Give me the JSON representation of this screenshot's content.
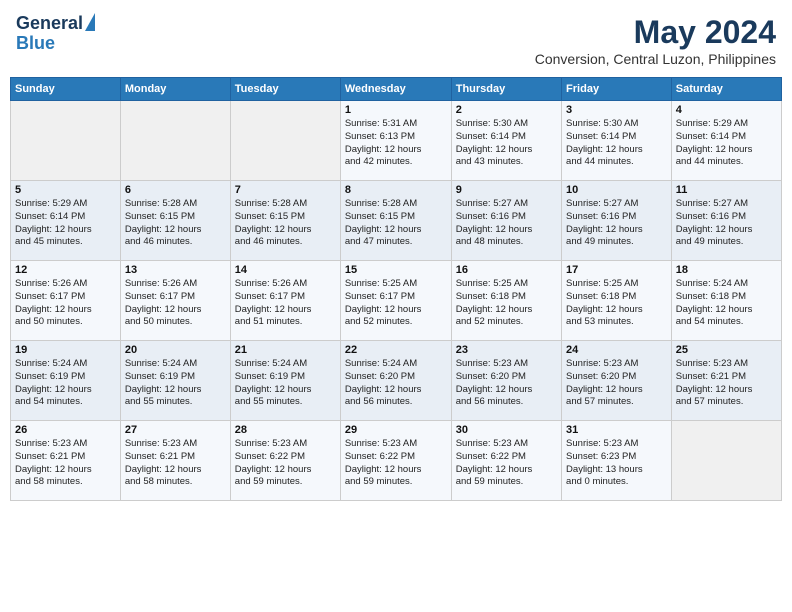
{
  "header": {
    "logo_line1": "General",
    "logo_line2": "Blue",
    "month_year": "May 2024",
    "location": "Conversion, Central Luzon, Philippines"
  },
  "weekdays": [
    "Sunday",
    "Monday",
    "Tuesday",
    "Wednesday",
    "Thursday",
    "Friday",
    "Saturday"
  ],
  "weeks": [
    [
      {
        "day": "",
        "info": ""
      },
      {
        "day": "",
        "info": ""
      },
      {
        "day": "",
        "info": ""
      },
      {
        "day": "1",
        "info": "Sunrise: 5:31 AM\nSunset: 6:13 PM\nDaylight: 12 hours\nand 42 minutes."
      },
      {
        "day": "2",
        "info": "Sunrise: 5:30 AM\nSunset: 6:14 PM\nDaylight: 12 hours\nand 43 minutes."
      },
      {
        "day": "3",
        "info": "Sunrise: 5:30 AM\nSunset: 6:14 PM\nDaylight: 12 hours\nand 44 minutes."
      },
      {
        "day": "4",
        "info": "Sunrise: 5:29 AM\nSunset: 6:14 PM\nDaylight: 12 hours\nand 44 minutes."
      }
    ],
    [
      {
        "day": "5",
        "info": "Sunrise: 5:29 AM\nSunset: 6:14 PM\nDaylight: 12 hours\nand 45 minutes."
      },
      {
        "day": "6",
        "info": "Sunrise: 5:28 AM\nSunset: 6:15 PM\nDaylight: 12 hours\nand 46 minutes."
      },
      {
        "day": "7",
        "info": "Sunrise: 5:28 AM\nSunset: 6:15 PM\nDaylight: 12 hours\nand 46 minutes."
      },
      {
        "day": "8",
        "info": "Sunrise: 5:28 AM\nSunset: 6:15 PM\nDaylight: 12 hours\nand 47 minutes."
      },
      {
        "day": "9",
        "info": "Sunrise: 5:27 AM\nSunset: 6:16 PM\nDaylight: 12 hours\nand 48 minutes."
      },
      {
        "day": "10",
        "info": "Sunrise: 5:27 AM\nSunset: 6:16 PM\nDaylight: 12 hours\nand 49 minutes."
      },
      {
        "day": "11",
        "info": "Sunrise: 5:27 AM\nSunset: 6:16 PM\nDaylight: 12 hours\nand 49 minutes."
      }
    ],
    [
      {
        "day": "12",
        "info": "Sunrise: 5:26 AM\nSunset: 6:17 PM\nDaylight: 12 hours\nand 50 minutes."
      },
      {
        "day": "13",
        "info": "Sunrise: 5:26 AM\nSunset: 6:17 PM\nDaylight: 12 hours\nand 50 minutes."
      },
      {
        "day": "14",
        "info": "Sunrise: 5:26 AM\nSunset: 6:17 PM\nDaylight: 12 hours\nand 51 minutes."
      },
      {
        "day": "15",
        "info": "Sunrise: 5:25 AM\nSunset: 6:17 PM\nDaylight: 12 hours\nand 52 minutes."
      },
      {
        "day": "16",
        "info": "Sunrise: 5:25 AM\nSunset: 6:18 PM\nDaylight: 12 hours\nand 52 minutes."
      },
      {
        "day": "17",
        "info": "Sunrise: 5:25 AM\nSunset: 6:18 PM\nDaylight: 12 hours\nand 53 minutes."
      },
      {
        "day": "18",
        "info": "Sunrise: 5:24 AM\nSunset: 6:18 PM\nDaylight: 12 hours\nand 54 minutes."
      }
    ],
    [
      {
        "day": "19",
        "info": "Sunrise: 5:24 AM\nSunset: 6:19 PM\nDaylight: 12 hours\nand 54 minutes."
      },
      {
        "day": "20",
        "info": "Sunrise: 5:24 AM\nSunset: 6:19 PM\nDaylight: 12 hours\nand 55 minutes."
      },
      {
        "day": "21",
        "info": "Sunrise: 5:24 AM\nSunset: 6:19 PM\nDaylight: 12 hours\nand 55 minutes."
      },
      {
        "day": "22",
        "info": "Sunrise: 5:24 AM\nSunset: 6:20 PM\nDaylight: 12 hours\nand 56 minutes."
      },
      {
        "day": "23",
        "info": "Sunrise: 5:23 AM\nSunset: 6:20 PM\nDaylight: 12 hours\nand 56 minutes."
      },
      {
        "day": "24",
        "info": "Sunrise: 5:23 AM\nSunset: 6:20 PM\nDaylight: 12 hours\nand 57 minutes."
      },
      {
        "day": "25",
        "info": "Sunrise: 5:23 AM\nSunset: 6:21 PM\nDaylight: 12 hours\nand 57 minutes."
      }
    ],
    [
      {
        "day": "26",
        "info": "Sunrise: 5:23 AM\nSunset: 6:21 PM\nDaylight: 12 hours\nand 58 minutes."
      },
      {
        "day": "27",
        "info": "Sunrise: 5:23 AM\nSunset: 6:21 PM\nDaylight: 12 hours\nand 58 minutes."
      },
      {
        "day": "28",
        "info": "Sunrise: 5:23 AM\nSunset: 6:22 PM\nDaylight: 12 hours\nand 59 minutes."
      },
      {
        "day": "29",
        "info": "Sunrise: 5:23 AM\nSunset: 6:22 PM\nDaylight: 12 hours\nand 59 minutes."
      },
      {
        "day": "30",
        "info": "Sunrise: 5:23 AM\nSunset: 6:22 PM\nDaylight: 12 hours\nand 59 minutes."
      },
      {
        "day": "31",
        "info": "Sunrise: 5:23 AM\nSunset: 6:23 PM\nDaylight: 13 hours\nand 0 minutes."
      },
      {
        "day": "",
        "info": ""
      }
    ]
  ]
}
